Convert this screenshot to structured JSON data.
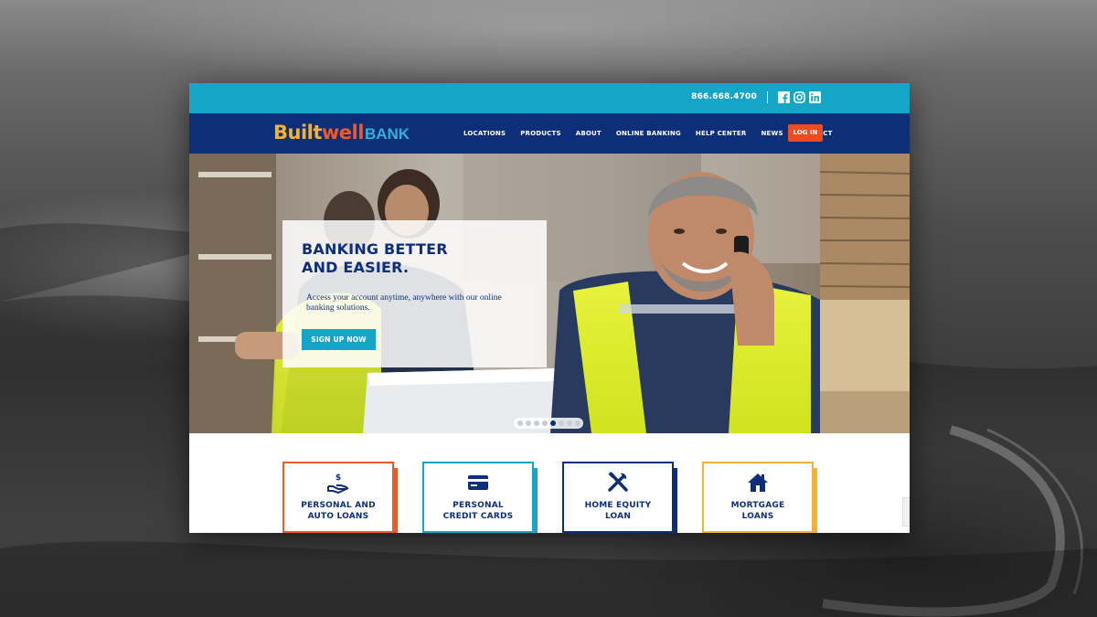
{
  "topbar": {
    "phone": "866.668.4700",
    "social": [
      "facebook-icon",
      "instagram-icon",
      "linkedin-icon"
    ]
  },
  "brand": {
    "part1": "Built",
    "part2": "well",
    "part3": "BANK"
  },
  "nav": {
    "items": [
      "LOCATIONS",
      "PRODUCTS",
      "ABOUT",
      "ONLINE BANKING",
      "HELP CENTER",
      "NEWS",
      "CONTACT"
    ],
    "login": "LOG IN"
  },
  "hero": {
    "title_line1": "BANKING BETTER",
    "title_line2": "AND EASIER.",
    "text": "Access your account anytime, anywhere with our online banking solutions.",
    "button": "SIGN UP NOW",
    "slides_total": 8,
    "active_slide": 5
  },
  "products": [
    {
      "line1": "PERSONAL AND",
      "line2": "AUTO LOANS",
      "icon": "hand-dollar-icon",
      "color": "#ee5a2a"
    },
    {
      "line1": "PERSONAL",
      "line2": "CREDIT CARDS",
      "icon": "credit-card-icon",
      "color": "#16a4c7"
    },
    {
      "line1": "HOME EQUITY",
      "line2": "LOAN",
      "icon": "tools-icon",
      "color": "#0d2f7a"
    },
    {
      "line1": "MORTGAGE",
      "line2": "LOANS",
      "icon": "house-icon",
      "color": "#f2b233"
    }
  ],
  "colors": {
    "topbar": "#16a4c7",
    "nav": "#0d2f7a",
    "accent_orange": "#ee4b1f",
    "accent_yellow": "#f2b233"
  }
}
